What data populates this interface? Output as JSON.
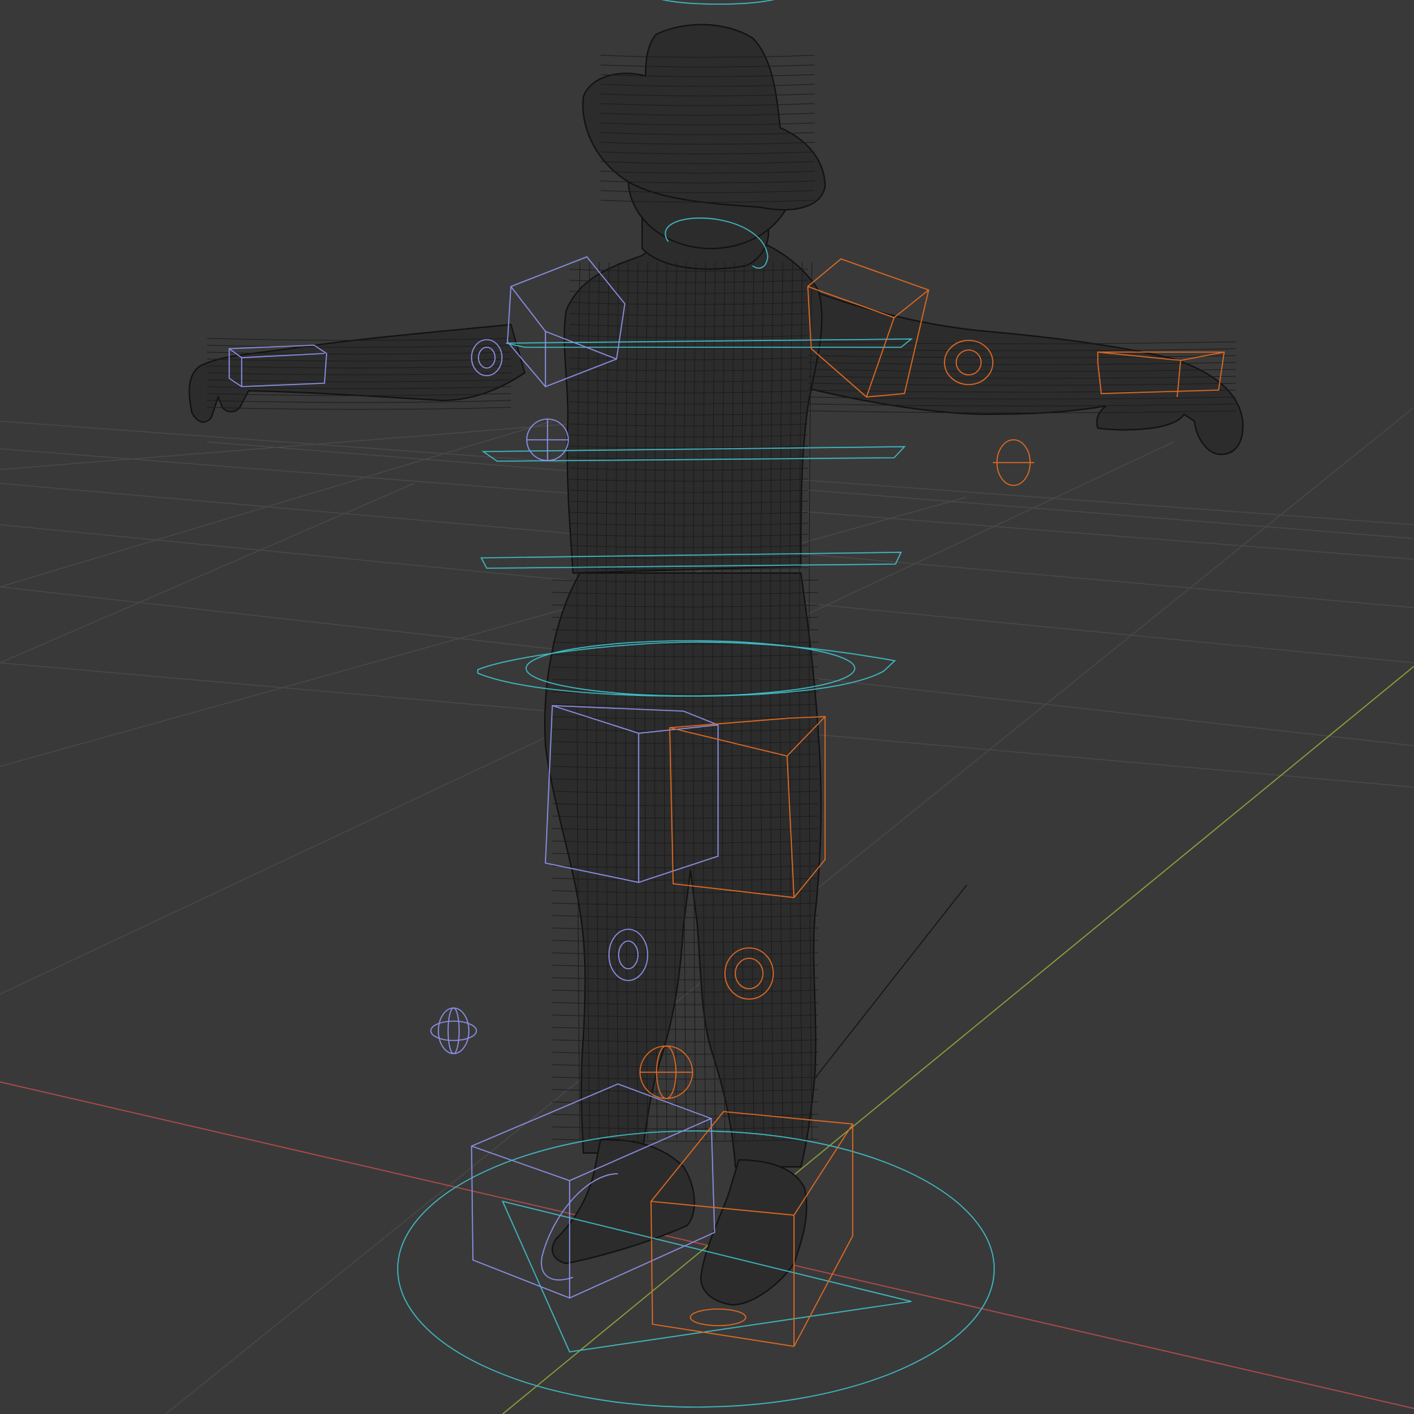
{
  "viewport": {
    "background": "#393939",
    "grid_color": "#4a4a4a",
    "axis_x_color": "#b34a4a",
    "axis_y_color": "#8aa33a"
  },
  "scene": {
    "mesh_color": "#141414",
    "control_colors": {
      "center": "#3fb9c2",
      "left": "#8c8fe6",
      "right": "#e06a22"
    },
    "icons": [
      "character-mesh-icon",
      "rig-control-icon",
      "ground-grid-icon",
      "origin-empty-icon"
    ]
  }
}
